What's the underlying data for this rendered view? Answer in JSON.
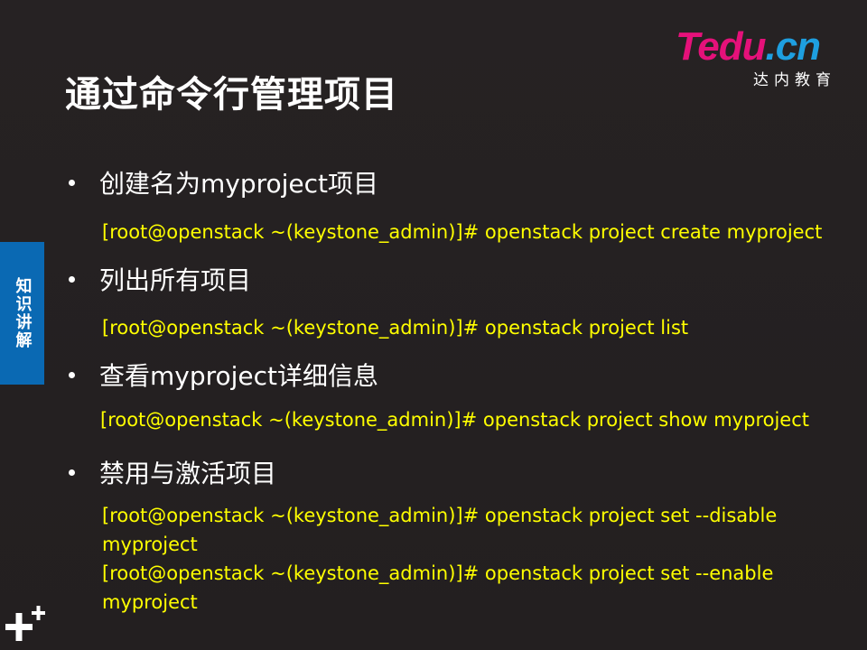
{
  "slide": {
    "title": "通过命令行管理项目",
    "logo": {
      "brand_t": "T",
      "brand_edu": "edu",
      "brand_dot_cn": ".cn",
      "subtitle": "达内教育"
    },
    "side_tab": "知识讲解",
    "items": [
      {
        "bullet": "创建名为myproject项目",
        "commands": [
          "[root@openstack ~(keystone_admin)]# openstack project create myproject"
        ]
      },
      {
        "bullet": "列出所有项目",
        "commands": [
          "[root@openstack ~(keystone_admin)]# openstack project list"
        ]
      },
      {
        "bullet": "查看myproject详细信息",
        "commands": [
          "[root@openstack ~(keystone_admin)]# openstack project show myproject"
        ]
      },
      {
        "bullet": "禁用与激活项目",
        "commands": [
          "[root@openstack ~(keystone_admin)]# openstack project set --disable",
          "myproject",
          "[root@openstack ~(keystone_admin)]# openstack project set --enable",
          "myproject"
        ]
      }
    ]
  },
  "colors": {
    "background": "#231f20",
    "title": "#ffffff",
    "bullet_text": "#ffffff",
    "command_text": "#ffff00",
    "side_tab": "#0a69b3",
    "logo_magenta": "#e5117a",
    "logo_blue": "#1e9fe0"
  },
  "icons": {
    "bullet": "bullet-dot",
    "corner": "plus-plus-icon"
  }
}
